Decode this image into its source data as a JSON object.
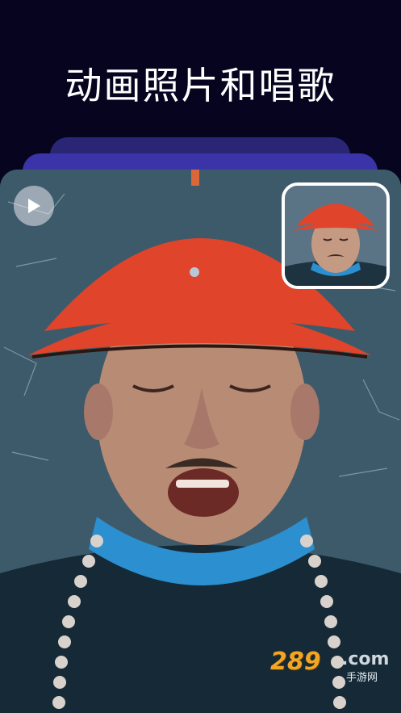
{
  "header": {
    "title": "动画照片和唱歌"
  },
  "player": {
    "play_icon": "play-icon",
    "thumbnail_icon": "source-photo-thumbnail"
  },
  "watermark": {
    "brand": "289",
    "domain_suffix": ".com",
    "tagline": "手游网"
  },
  "colors": {
    "background": "#07041f",
    "card_stack_back": "#2a2575",
    "card_stack_mid": "#3a34a8",
    "hat": "#e0442a",
    "collar": "#2b8fd0"
  }
}
